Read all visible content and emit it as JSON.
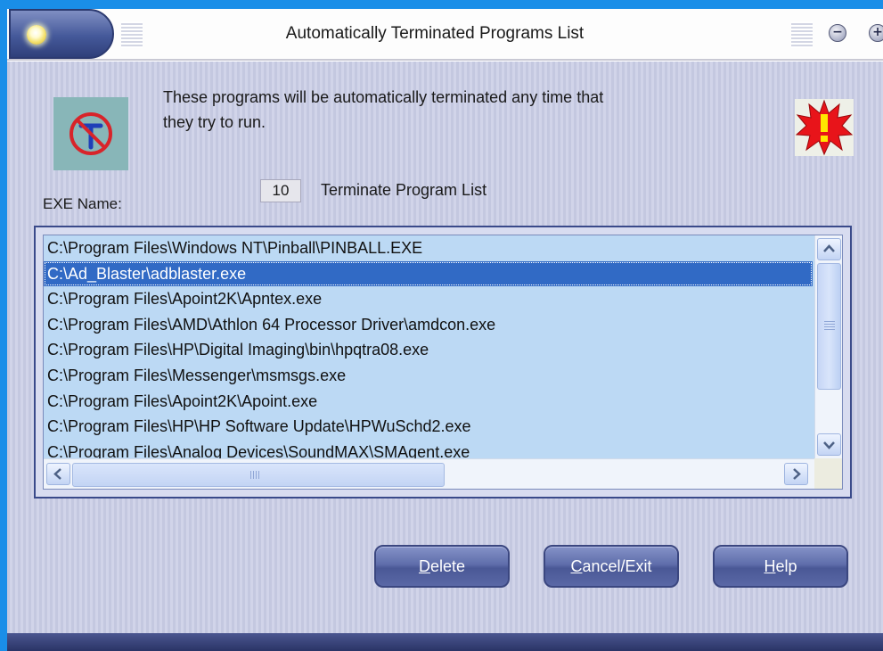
{
  "window": {
    "title": "Automatically Terminated Programs List",
    "minimize_glyph": "−",
    "maximize_glyph": "+"
  },
  "icons": {
    "left": "no-terminate-icon",
    "right": "warning-burst-icon"
  },
  "info": {
    "line1": "These programs will be automatically terminated any time that",
    "line2": "they try to run."
  },
  "exe_label": "EXE Name:",
  "list": {
    "count": "10",
    "title": "Terminate Program List",
    "selected_index": 1,
    "items": [
      "C:\\Program Files\\Windows NT\\Pinball\\PINBALL.EXE",
      "C:\\Ad_Blaster\\adblaster.exe",
      "C:\\Program Files\\Apoint2K\\Apntex.exe",
      "C:\\Program Files\\AMD\\Athlon 64 Processor Driver\\amdcon.exe",
      "C:\\Program Files\\HP\\Digital Imaging\\bin\\hpqtra08.exe",
      "C:\\Program Files\\Messenger\\msmsgs.exe",
      "C:\\Program Files\\Apoint2K\\Apoint.exe",
      "C:\\Program Files\\HP\\HP Software Update\\HPWuSchd2.exe",
      "C:\\Program Files\\Analog Devices\\SoundMAX\\SMAgent.exe"
    ]
  },
  "buttons": {
    "delete": {
      "mnemonic": "D",
      "rest": "elete"
    },
    "cancel": {
      "mnemonic": "C",
      "rest": "ancel/Exit"
    },
    "help": {
      "mnemonic": "H",
      "rest": "elp"
    }
  },
  "colors": {
    "selection": "#316ac5",
    "list_background": "#bcd9f4",
    "desktop": "#1a8ee8"
  }
}
